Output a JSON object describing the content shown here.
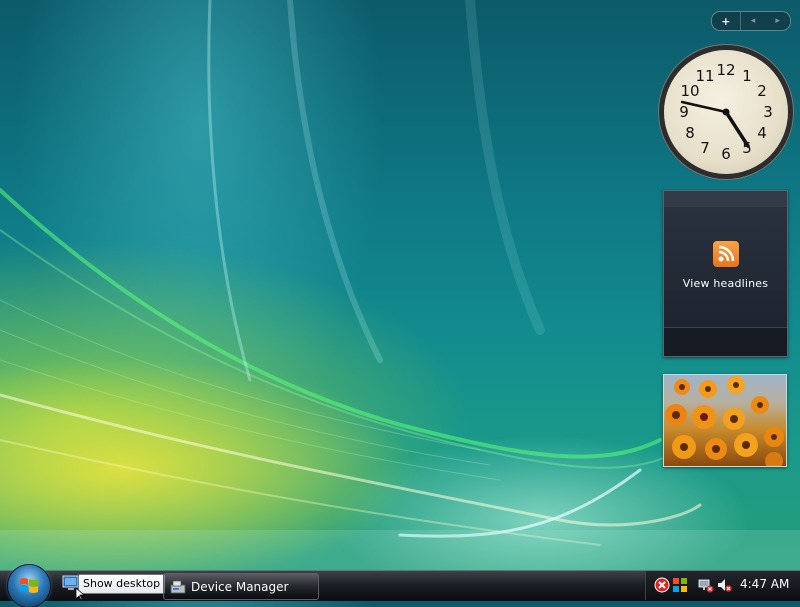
{
  "sidebar": {
    "controls": {
      "add_label": "+",
      "prev_label": "◂",
      "next_label": "▸"
    },
    "clock_gadget": {
      "numerals": [
        "12",
        "1",
        "2",
        "3",
        "4",
        "5",
        "6",
        "7",
        "8",
        "9",
        "10",
        "11"
      ],
      "time": "4:47"
    },
    "feed_gadget": {
      "label": "View headlines"
    },
    "slideshow_gadget": {
      "subject": "orange flowers"
    }
  },
  "taskbar": {
    "quick_launch_tooltip": "Show desktop",
    "tasks": [
      {
        "label": "Device Manager"
      }
    ],
    "tray": {
      "time": "4:47 AM"
    }
  },
  "colors": {
    "feed_orange": "#f28a2e",
    "taskbar": "#1c1f24"
  }
}
